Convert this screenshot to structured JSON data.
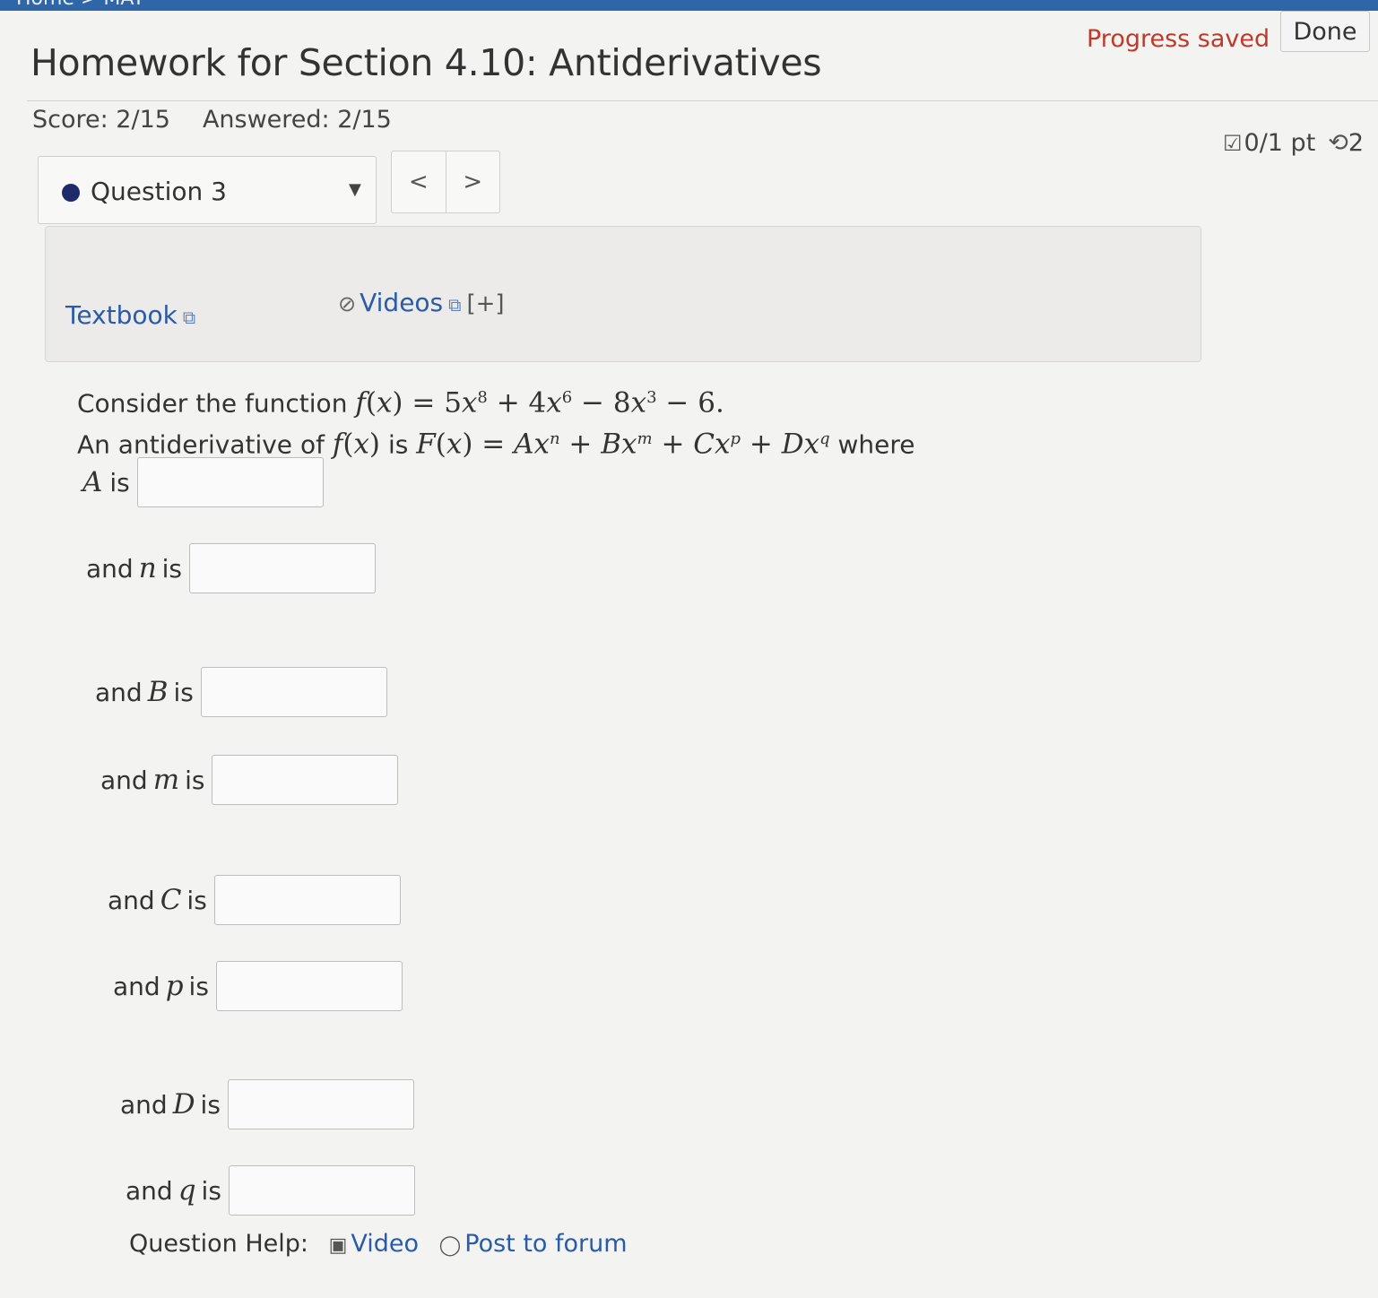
{
  "topbar": {
    "crumb": "Home > MAT"
  },
  "header": {
    "title": "Homework for Section 4.10: Antiderivatives",
    "progress": "Progress saved",
    "done_label": "Done",
    "score": "Score: 2/15",
    "answered": "Answered: 2/15",
    "points": "0/1 pt",
    "retries": "2"
  },
  "question_nav": {
    "current": "Question 3",
    "prev": "<",
    "next": ">"
  },
  "help_links": {
    "textbook": "Textbook",
    "videos": "Videos",
    "videos_expand": "[+]"
  },
  "prompt": {
    "line1_text": "Consider the function",
    "line2_text_a": "An antiderivative of",
    "line2_text_b": "is",
    "line2_text_c": "where"
  },
  "fields": [
    {
      "label": "is",
      "var": "A",
      "value": ""
    },
    {
      "label": "and",
      "var": "n",
      "value": ""
    },
    {
      "label": "and",
      "var": "B",
      "value": ""
    },
    {
      "label": "and",
      "var": "m",
      "value": ""
    },
    {
      "label": "and",
      "var": "C",
      "value": ""
    },
    {
      "label": "and",
      "var": "p",
      "value": ""
    },
    {
      "label": "and",
      "var": "D",
      "value": ""
    },
    {
      "label": "and",
      "var": "q",
      "value": ""
    }
  ],
  "question_help": {
    "label": "Question Help:",
    "video": "Video",
    "forum": "Post to forum"
  }
}
